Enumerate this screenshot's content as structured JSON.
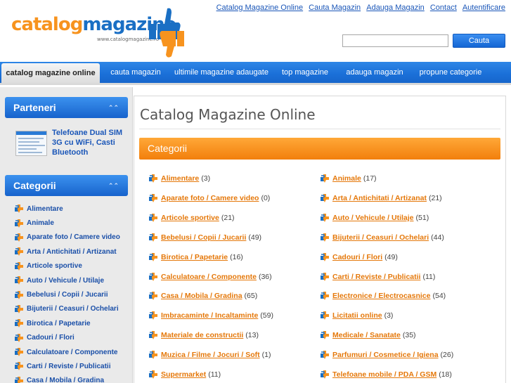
{
  "header": {
    "logo_part1": "catalog",
    "logo_part2": "magazine",
    "logo_url": "www.catalogmagazine.ro",
    "top_links": [
      "Catalog Magazine Online",
      "Cauta Magazin",
      "Adauga Magazin",
      "Contact",
      "Autentificare"
    ],
    "search_placeholder": "",
    "search_button": "Cauta"
  },
  "nav": {
    "items": [
      "catalog magazine online",
      "cauta magazin",
      "ultimile magazine adaugate",
      "top magazine",
      "adauga magazin",
      "propune categorie"
    ],
    "active_index": 0
  },
  "sidebar": {
    "partners_title": "Parteneri",
    "partner_link": "Telefoane Dual SIM 3G cu WiFi, Casti Bluetooth",
    "categories_title": "Categorii",
    "categories": [
      "Alimentare",
      "Animale",
      "Aparate foto / Camere video",
      "Arta / Antichitati / Artizanat",
      "Articole sportive",
      "Auto / Vehicule / Utilaje",
      "Bebelusi / Copii / Jucarii",
      "Bijuterii / Ceasuri / Ochelari",
      "Birotica / Papetarie",
      "Cadouri / Flori",
      "Calculatoare / Componente",
      "Carti / Reviste / Publicatii",
      "Casa / Mobila / Gradina"
    ]
  },
  "main": {
    "title": "Catalog Magazine Online",
    "categories_bar": "Categorii",
    "left_column": [
      {
        "name": "Alimentare",
        "count": "(3)"
      },
      {
        "name": "Aparate foto / Camere video",
        "count": "(0)"
      },
      {
        "name": "Articole sportive",
        "count": "(21)"
      },
      {
        "name": "Bebelusi / Copii / Jucarii",
        "count": "(49)"
      },
      {
        "name": "Birotica / Papetarie",
        "count": "(16)"
      },
      {
        "name": "Calculatoare / Componente",
        "count": "(36)"
      },
      {
        "name": "Casa / Mobila / Gradina",
        "count": "(65)"
      },
      {
        "name": "Imbracaminte / Incaltaminte",
        "count": "(59)"
      },
      {
        "name": "Materiale de constructii",
        "count": "(13)"
      },
      {
        "name": "Muzica / Filme / Jocuri / Soft",
        "count": "(1)"
      },
      {
        "name": "Supermarket",
        "count": "(11)"
      }
    ],
    "right_column": [
      {
        "name": "Animale",
        "count": "(17)"
      },
      {
        "name": "Arta / Antichitati / Artizanat",
        "count": "(21)"
      },
      {
        "name": "Auto / Vehicule / Utilaje",
        "count": "(51)"
      },
      {
        "name": "Bijuterii / Ceasuri / Ochelari",
        "count": "(44)"
      },
      {
        "name": "Cadouri / Flori",
        "count": "(49)"
      },
      {
        "name": "Carti / Reviste / Publicatii",
        "count": "(11)"
      },
      {
        "name": "Electronice / Electrocasnice",
        "count": "(54)"
      },
      {
        "name": "Licitatii online",
        "count": "(3)"
      },
      {
        "name": "Medicale / Sanatate",
        "count": "(35)"
      },
      {
        "name": "Parfumuri / Cosmetice / Igiena",
        "count": "(26)"
      },
      {
        "name": "Telefoane mobile / PDA / GSM",
        "count": "(18)"
      }
    ]
  },
  "colors": {
    "nav_blue": "#1a6fd8",
    "orange_accent": "#f7931e",
    "link_blue": "#1a56b8",
    "category_link": "#e5780a"
  },
  "icons": {
    "logo": "thumbs-up-down-logo",
    "category": "puzzle-arrow-icon",
    "collapse": "chevron-up-icon"
  }
}
